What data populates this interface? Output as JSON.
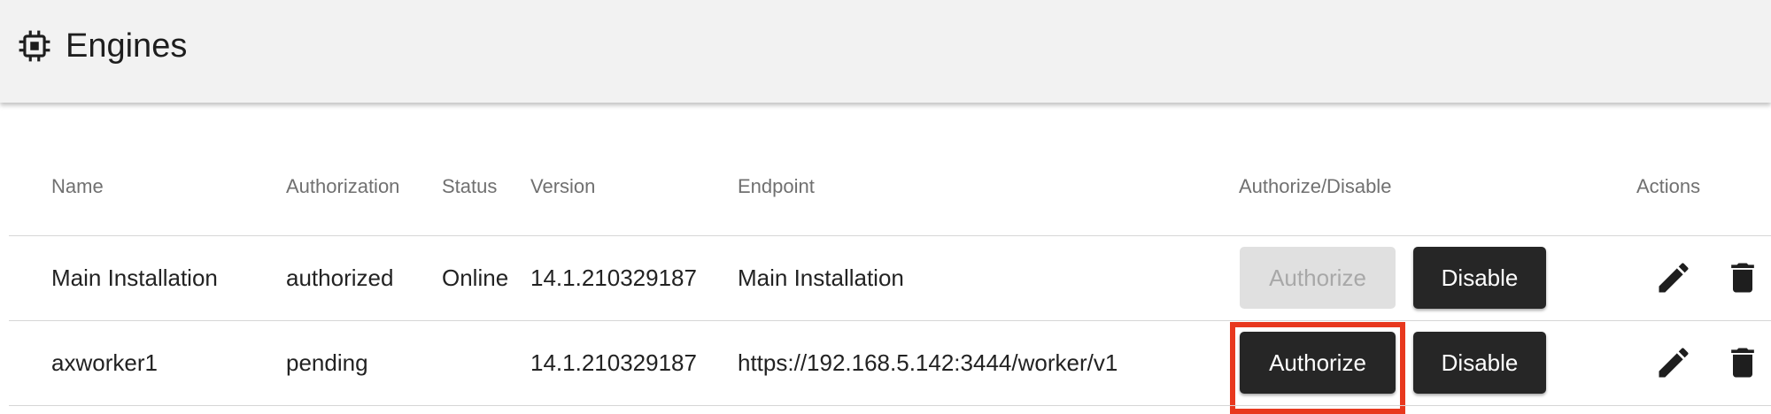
{
  "header": {
    "title": "Engines",
    "icon": "chip-icon"
  },
  "table": {
    "columns": {
      "name": "Name",
      "authorization": "Authorization",
      "status": "Status",
      "version": "Version",
      "endpoint": "Endpoint",
      "authorize_disable": "Authorize/Disable",
      "actions": "Actions"
    },
    "rows": [
      {
        "name": "Main Installation",
        "authorization": "authorized",
        "status": "Online",
        "version": "14.1.210329187",
        "endpoint": "Main Installation",
        "authorize_label": "Authorize",
        "authorize_enabled": false,
        "disable_label": "Disable"
      },
      {
        "name": "axworker1",
        "authorization": "pending",
        "status": "",
        "version": "14.1.210329187",
        "endpoint": "https://192.168.5.142:3444/worker/v1",
        "authorize_label": "Authorize",
        "authorize_enabled": true,
        "highlighted": true,
        "disable_label": "Disable"
      }
    ]
  },
  "colors": {
    "header_bg": "#f2f2f2",
    "button_dark": "#262626",
    "button_disabled": "#e0e0e0",
    "highlight": "#e8381e"
  },
  "icons": [
    "chip-icon",
    "edit-icon",
    "delete-icon"
  ]
}
